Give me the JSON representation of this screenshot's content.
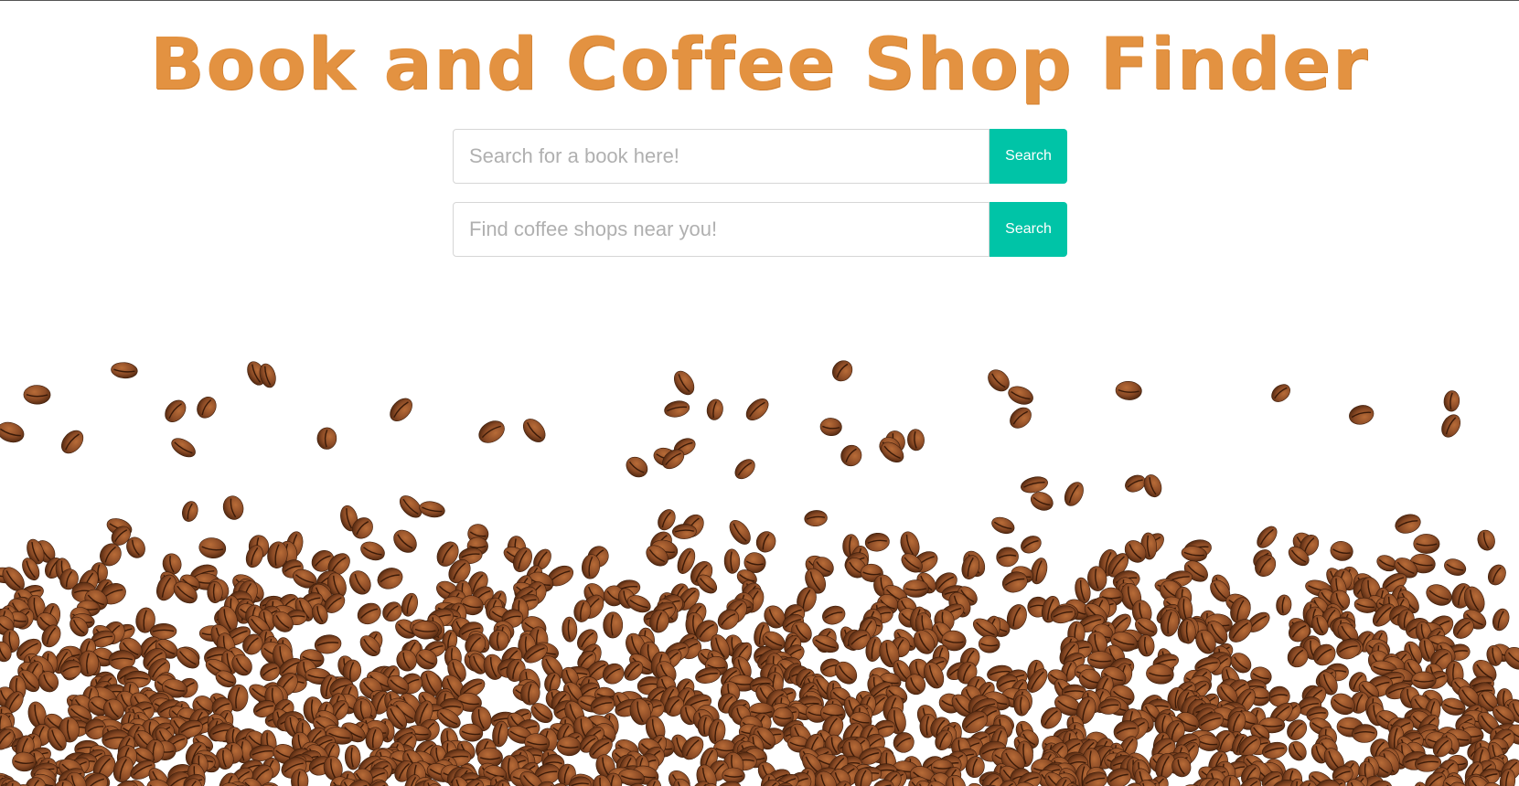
{
  "header": {
    "title": "Book and Coffee Shop Finder"
  },
  "book_search": {
    "placeholder": "Search for a book here!",
    "button_label": "Search"
  },
  "coffee_search": {
    "placeholder": "Find coffee shops near you!",
    "button_label": "Search"
  },
  "colors": {
    "title": "#e39241",
    "button": "#00c4a7",
    "bean_dark": "#5a2e14",
    "bean_mid": "#8a4a25",
    "bean_light": "#a8602f"
  },
  "background_image": "coffee-beans"
}
